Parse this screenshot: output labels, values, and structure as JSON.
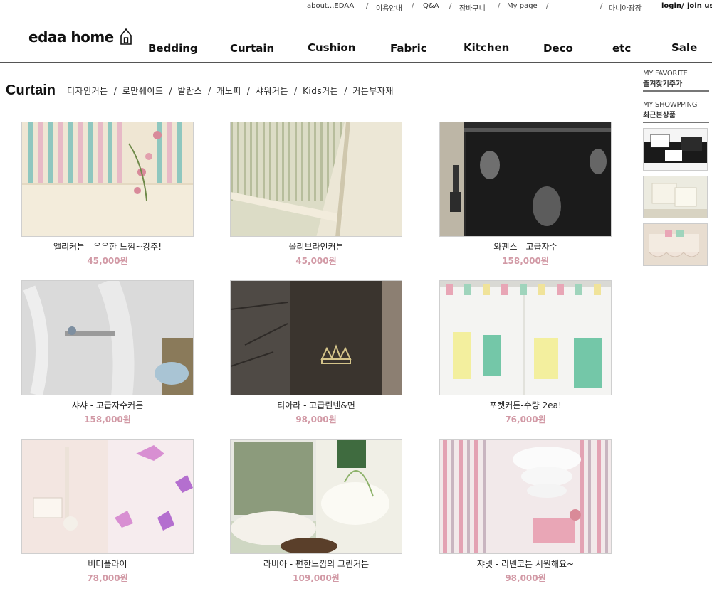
{
  "top_links": {
    "about": "about...EDAA",
    "guide": "이용안내",
    "qna": "Q&A",
    "cart": "장바구니",
    "mypage": "My page",
    "mania": "마니아광장",
    "login": "login",
    "join": "join us",
    "separator": "/"
  },
  "logo": {
    "text": "edaa home"
  },
  "main_nav": [
    "Bedding",
    "Curtain",
    "Cushion",
    "Fabric",
    "Kitchen",
    "Deco",
    "etc",
    "Sale"
  ],
  "section": {
    "title": "Curtain",
    "subcategories": [
      "디자인커튼",
      "로만쉐이드",
      "발란스",
      "캐노피",
      "샤워커튼",
      "Kids커튼",
      "커튼부자재"
    ],
    "separator": "/"
  },
  "products": [
    {
      "name": "앨리커튼 - 은은한 느낌~강추!",
      "price": "45,000원",
      "image": "pastel-striped-curtain-with-roses"
    },
    {
      "name": "올리브라인커튼",
      "price": "45,000원",
      "image": "olive-striped-lace-curtain"
    },
    {
      "name": "와펜스 - 고급자수",
      "price": "158,000원",
      "image": "black-embroidered-curtain-with-tassel"
    },
    {
      "name": "샤샤 - 고급자수커튼",
      "price": "158,000원",
      "image": "sheer-white-embroidered-curtain"
    },
    {
      "name": "티아라 - 고급린넨&면",
      "price": "98,000원",
      "image": "dark-linen-curtain-crown-embroidery"
    },
    {
      "name": "포켓커튼-수량 2ea!",
      "price": "76,000원",
      "image": "white-pocket-curtain"
    },
    {
      "name": "버터플라이",
      "price": "78,000원",
      "image": "sheer-butterfly-curtain"
    },
    {
      "name": "라비아 - 편한느낌의 그린커튼",
      "price": "109,000원",
      "image": "green-floral-curtain-with-cushions"
    },
    {
      "name": "쟈넷 - 리넨코튼 시원해요~",
      "price": "98,000원",
      "image": "pink-striped-linen-curtain"
    }
  ],
  "side_panel": {
    "favorite_en": "MY FAVORITE",
    "favorite_ko": "즐겨찾기추가",
    "shopping_en": "MY SHOWPPING",
    "shopping_ko": "최근본상품",
    "recent_items": [
      "black-white-bedding",
      "cream-cushions",
      "ruffled-pastel-item"
    ]
  },
  "colors": {
    "price": "#d29aa6",
    "header_line": "#555555"
  }
}
